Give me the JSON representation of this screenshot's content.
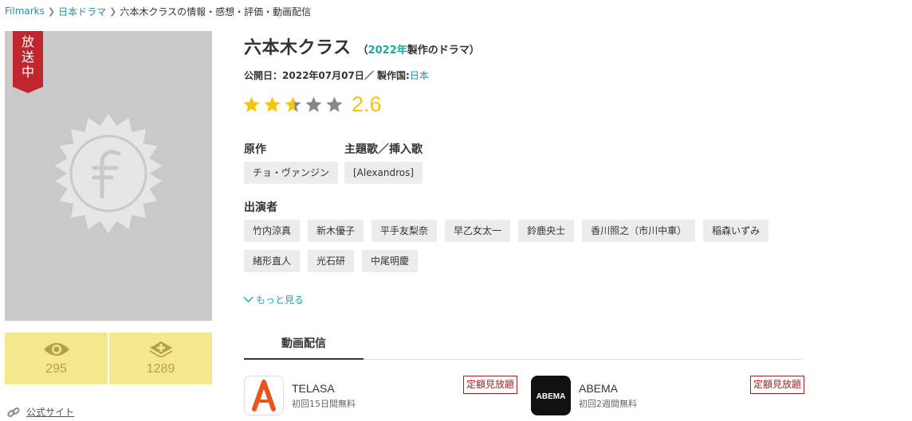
{
  "breadcrumb": {
    "items": [
      "Filmarks",
      "日本ドラマ"
    ],
    "current": "六本木クラスの情報・感想・評価・動画配信"
  },
  "poster": {
    "ribbon_text": "放送中",
    "ribbon_color": "#c0262d",
    "placeholder_icon": "filmarks-emblem-icon"
  },
  "stats": {
    "watched_count": "295",
    "clip_count": "1289",
    "watched_icon": "eye-icon",
    "clip_icon": "clip-plus-icon"
  },
  "official_site": {
    "label": "公式サイト",
    "icon": "link-icon"
  },
  "work": {
    "title": "六本木クラス",
    "note_open": "（",
    "year": "2022年",
    "note_rest": "製作のドラマ）",
    "release_label": "公開日：",
    "release_date": "2022年07月07日",
    "country_sep": "／ 製作国:",
    "country": "日本"
  },
  "rating": {
    "score": "2.6",
    "value": 2.6,
    "max": 5,
    "star_color": "#f6c40b",
    "empty_color": "#888888"
  },
  "original": {
    "label": "原作",
    "tags": [
      "チョ・ヴァンジン"
    ]
  },
  "theme_song": {
    "label": "主題歌／挿入歌",
    "tags": [
      "[Alexandros]"
    ]
  },
  "cast": {
    "label": "出演者",
    "tags": [
      "竹内涼真",
      "新木優子",
      "平手友梨奈",
      "早乙女太一",
      "鈴鹿央士",
      "香川照之（市川中車）",
      "稲森いずみ",
      "緒形直人",
      "光石研",
      "中尾明慶"
    ],
    "more_label": "もっと見る"
  },
  "tabs": {
    "active": "動画配信"
  },
  "services": [
    {
      "name": "TELASA",
      "sub": "初回15日間無料",
      "badge": "定額見放題",
      "logo_icon": "telasa-logo-icon",
      "logo_color": "#e8541c"
    },
    {
      "name": "ABEMA",
      "sub": "初回2週間無料",
      "badge": "定額見放題",
      "logo_icon": "abema-logo-icon",
      "logo_text": "ABEMA",
      "logo_color": "#111111"
    }
  ],
  "accent": {
    "teal": "#1ea7a0",
    "link": "#1f8fb0",
    "stats_bg": "#f5e78c"
  }
}
